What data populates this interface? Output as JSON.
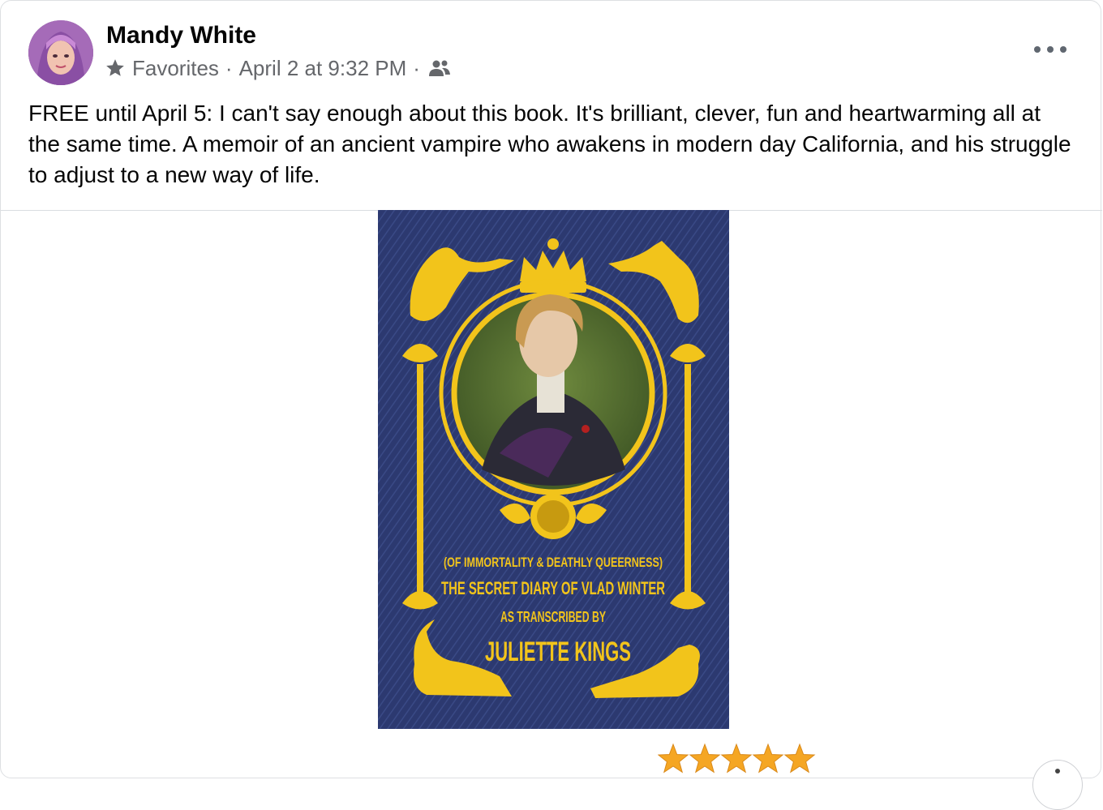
{
  "post": {
    "author": "Mandy White",
    "audience": "Favorites",
    "separator": "·",
    "timestamp": "April 2 at 9:32 PM",
    "text": "FREE until April 5: I can't say enough about this book. It's brilliant, clever, fun and heartwarming all at the same time. A memoir of an ancient vampire who awakens in modern day California, and his struggle to adjust to a new way of life."
  },
  "book": {
    "subtitle": "(OF IMMORTALITY & DEATHLY QUEERNESS)",
    "title": "THE SECRET DIARY OF VLAD WINTER",
    "transcribed": "AS TRANSCRIBED BY",
    "author": "JULIETTE KINGS"
  },
  "rating": {
    "stars": 5,
    "max": 5
  },
  "colors": {
    "cover_blue": "#2c3970",
    "gold": "#f2c41b",
    "meta_gray": "#65676b"
  },
  "icons": {
    "favorites": "star-icon",
    "audience": "friends-icon",
    "menu": "more-options-icon"
  }
}
